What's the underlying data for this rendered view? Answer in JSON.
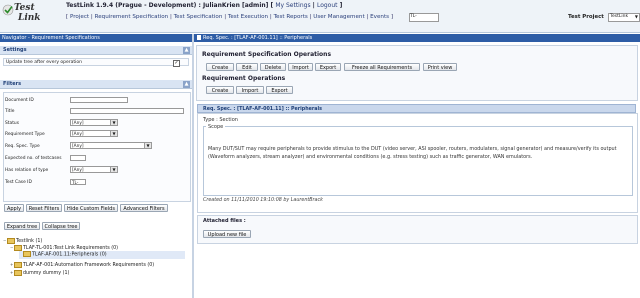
{
  "header": {
    "logo_line1": "Test",
    "logo_line2": "Link",
    "title": "TestLink 1.9.4 (Prague - Development) : JulianKrien [admin]",
    "my_settings": "My Settings",
    "logout": "Logout",
    "nav_items": [
      "Project",
      "Requirement Specification",
      "Test Specification",
      "Test Execution",
      "Test Reports",
      "User Management",
      "Events"
    ],
    "search_value": "TL-",
    "test_project_label": "Test Project",
    "test_project_value": "TestLink"
  },
  "left": {
    "title": "Navigator - Requirement Specifications",
    "settings_heading": "Settings",
    "settings_checkbox_label": "Update tree after every operation",
    "settings_checked": "✓",
    "filters_heading": "Filters",
    "filters": [
      {
        "label": "Document ID",
        "type": "input",
        "value": ""
      },
      {
        "label": "Title",
        "type": "input",
        "value": ""
      },
      {
        "label": "Status",
        "type": "select",
        "value": "[Any]"
      },
      {
        "label": "Requirement Type",
        "type": "select",
        "value": "[Any]"
      },
      {
        "label": "Req. Spec. Type",
        "type": "select",
        "value": "[Any]"
      },
      {
        "label": "Expected no. of testcases",
        "type": "input",
        "value": ""
      },
      {
        "label": "Has relation of type",
        "type": "select",
        "value": "[Any]"
      },
      {
        "label": "Test Case ID",
        "type": "input",
        "value": "TL-"
      }
    ],
    "buttons": [
      "Apply",
      "Reset Filters",
      "Hide Custom Fields",
      "Advanced Filters"
    ],
    "expand_tree": "Expand tree",
    "collapse_tree": "Collapse tree",
    "tree": [
      {
        "label": "Testlink (1)",
        "level": 0,
        "twist": "−"
      },
      {
        "label": "TLAF-TL-001:Test Link Requirements (0)",
        "level": 1,
        "twist": "−"
      },
      {
        "label": "TLAF-AF-001.11:Peripherals (0)",
        "level": 2,
        "twist": ""
      },
      {
        "label": "TLAF-AF-001:Automation Framework Requirements (0)",
        "level": 1,
        "twist": "+"
      },
      {
        "label": "dummy dummy (1)",
        "level": 1,
        "twist": "+"
      }
    ]
  },
  "right": {
    "title": "Req. Spec. : [TLAF-AF-001.11] :: Peripherals",
    "spec_ops_heading": "Requirement Specification Operations",
    "spec_ops_buttons": [
      "Create",
      "Edit",
      "Delete",
      "Import",
      "Export",
      "Freeze all Requirements",
      "Print view"
    ],
    "req_ops_heading": "Requirement Operations",
    "req_ops_buttons": [
      "Create",
      "Import",
      "Export"
    ],
    "detail_title": "Req. Spec. : [TLAF-AF-001.11] :: Peripherals",
    "type_line": "Type : Section",
    "scope_label": "Scope",
    "scope_text": "Many DUT/SUT may require peripherals to provide stimulus to the DUT (video server, ASI spooler, routers, modulaters, signal generator) and measure/verify its output (Waveform analyzers, stream analyzer) and environmental conditions (e.g. stress testing) such as traffic generator, WAN emulators.",
    "created_on": "Created on 11/11/2010 19:10:08  by LaurentBrack",
    "attached_label": "Attached files :",
    "upload_button": "Upload new file"
  }
}
